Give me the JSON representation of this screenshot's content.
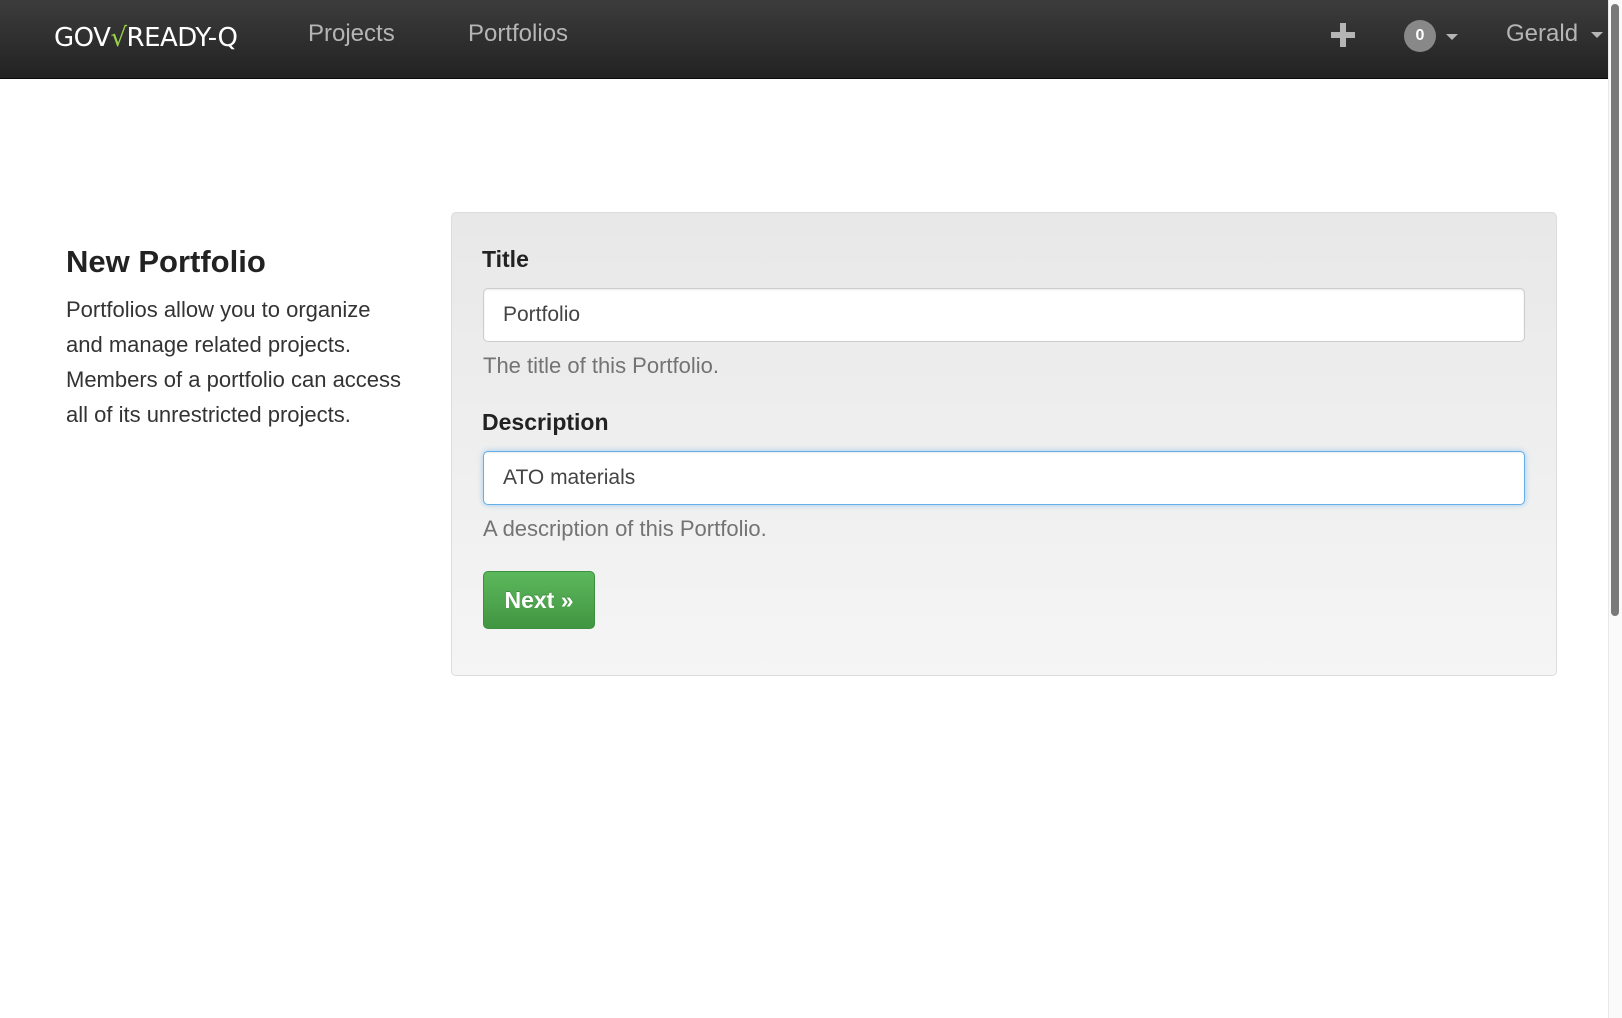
{
  "navbar": {
    "brand_prefix": "GOV",
    "brand_check": "√",
    "brand_suffix": "READY-Q",
    "links": [
      {
        "label": "Projects"
      },
      {
        "label": "Portfolios"
      }
    ],
    "plus_icon": "plus-icon",
    "notifications": {
      "count": "0"
    },
    "user": {
      "label": "Gerald"
    }
  },
  "intro": {
    "title": "New Portfolio",
    "text": "Portfolios allow you to organize and manage related projects. Members of a portfolio can access all of its unrestricted projects."
  },
  "form": {
    "title": {
      "label": "Title",
      "value": "Portfolio",
      "help": "The title of this Portfolio."
    },
    "description": {
      "label": "Description",
      "value": "ATO materials",
      "help": "A description of this Portfolio."
    },
    "next_label": "Next »"
  },
  "colors": {
    "navbar": "#2b2b2b",
    "brand_check": "#9ad14b",
    "success": "#5cb85c",
    "focus": "#66afe9"
  }
}
